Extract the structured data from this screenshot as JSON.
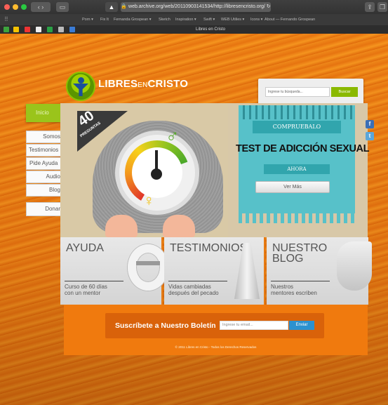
{
  "browser": {
    "url": "web.archive.org/web/20110903141534/http://libresencristo.org/",
    "tab_title": "Libres en Cristo",
    "bookmarks": [
      "Porn ▾",
      "Fix It",
      "Fernanda Grospean ▾",
      "Sketch",
      "Inspiration ▾",
      "Swift ▾",
      "WEB Utilies ▾",
      "Icons ▾",
      "About — Fernando Grospean"
    ]
  },
  "site": {
    "logo_main": "LIBRES",
    "logo_en": "EN",
    "logo_end": "CRISTO",
    "search_placeholder": "Ingrese tu búsqueda...",
    "search_button": "Buscar"
  },
  "nav": {
    "home": "Inicio",
    "items": [
      "Somos",
      "Testimonios",
      "Pide Ayuda",
      "Audio",
      "Blog"
    ],
    "donate": "Donar"
  },
  "hero": {
    "badge_number": "40",
    "badge_label": "PREGUNTAS",
    "banner_top": "COMPRUEBALO",
    "test_title": "TEST DE ADICCIÓN SEXUAL",
    "banner_bottom": "AHORA",
    "more_button": "Ver Más"
  },
  "panels": [
    {
      "title": "AYUDA",
      "subtitle_1": "Curso de 60 días",
      "subtitle_2": "con un mentor"
    },
    {
      "title": "TESTIMONIOS",
      "subtitle_1": "Vidas cambiadas",
      "subtitle_2": "después del pecado"
    },
    {
      "title_1": "NUESTRO",
      "title_2": "BLOG",
      "subtitle_1": "Nuestros",
      "subtitle_2": "mentores escriben"
    }
  ],
  "subscribe": {
    "label": "Suscríbete a Nuestro Boletín",
    "email_placeholder": "Ingrese tu email...",
    "button": "Enviar"
  },
  "footer": "© 2011 Libres en Cristo - Todos los Derechos Reservados",
  "social": [
    "f",
    "t"
  ]
}
